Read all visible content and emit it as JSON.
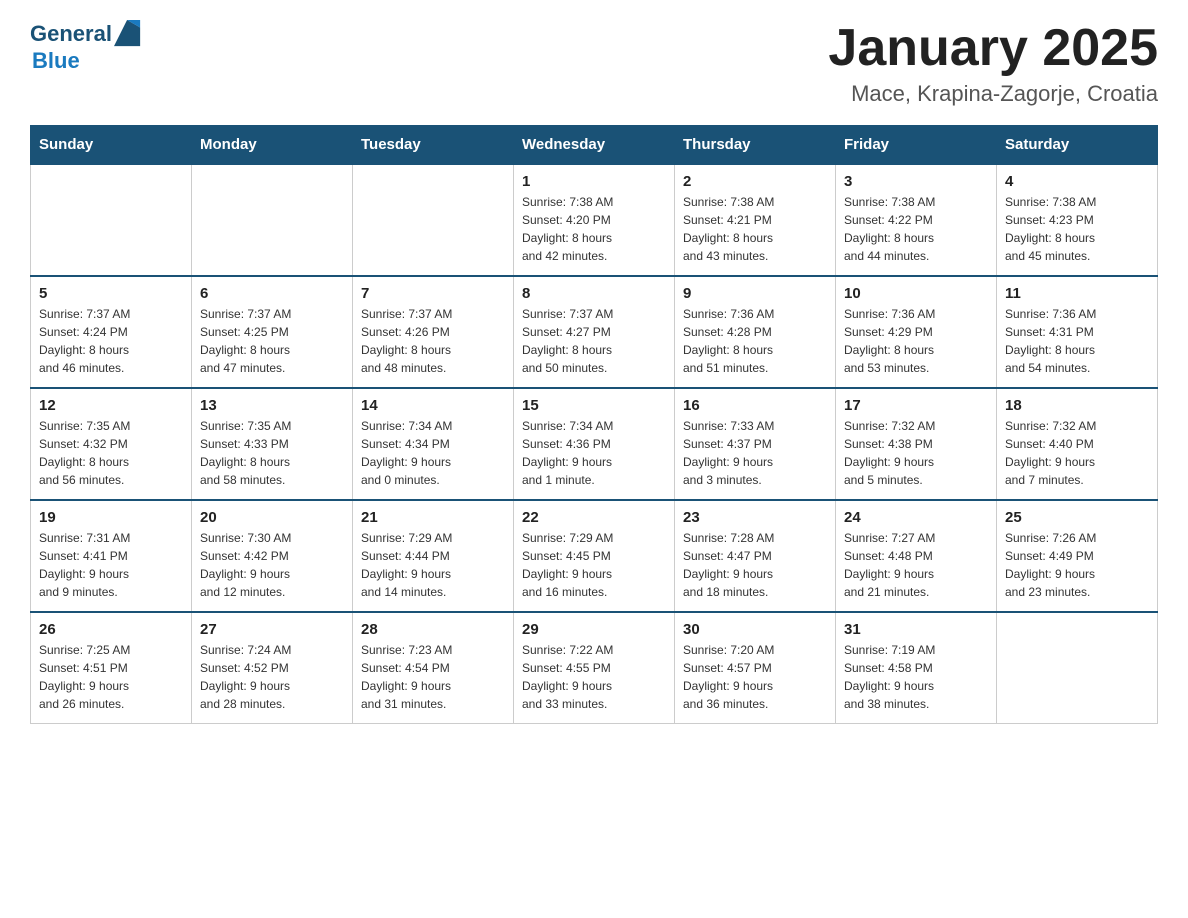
{
  "header": {
    "title": "January 2025",
    "subtitle": "Mace, Krapina-Zagorje, Croatia",
    "logo_general": "General",
    "logo_blue": "Blue"
  },
  "days_of_week": [
    "Sunday",
    "Monday",
    "Tuesday",
    "Wednesday",
    "Thursday",
    "Friday",
    "Saturday"
  ],
  "weeks": [
    [
      {
        "day": "",
        "info": ""
      },
      {
        "day": "",
        "info": ""
      },
      {
        "day": "",
        "info": ""
      },
      {
        "day": "1",
        "info": "Sunrise: 7:38 AM\nSunset: 4:20 PM\nDaylight: 8 hours\nand 42 minutes."
      },
      {
        "day": "2",
        "info": "Sunrise: 7:38 AM\nSunset: 4:21 PM\nDaylight: 8 hours\nand 43 minutes."
      },
      {
        "day": "3",
        "info": "Sunrise: 7:38 AM\nSunset: 4:22 PM\nDaylight: 8 hours\nand 44 minutes."
      },
      {
        "day": "4",
        "info": "Sunrise: 7:38 AM\nSunset: 4:23 PM\nDaylight: 8 hours\nand 45 minutes."
      }
    ],
    [
      {
        "day": "5",
        "info": "Sunrise: 7:37 AM\nSunset: 4:24 PM\nDaylight: 8 hours\nand 46 minutes."
      },
      {
        "day": "6",
        "info": "Sunrise: 7:37 AM\nSunset: 4:25 PM\nDaylight: 8 hours\nand 47 minutes."
      },
      {
        "day": "7",
        "info": "Sunrise: 7:37 AM\nSunset: 4:26 PM\nDaylight: 8 hours\nand 48 minutes."
      },
      {
        "day": "8",
        "info": "Sunrise: 7:37 AM\nSunset: 4:27 PM\nDaylight: 8 hours\nand 50 minutes."
      },
      {
        "day": "9",
        "info": "Sunrise: 7:36 AM\nSunset: 4:28 PM\nDaylight: 8 hours\nand 51 minutes."
      },
      {
        "day": "10",
        "info": "Sunrise: 7:36 AM\nSunset: 4:29 PM\nDaylight: 8 hours\nand 53 minutes."
      },
      {
        "day": "11",
        "info": "Sunrise: 7:36 AM\nSunset: 4:31 PM\nDaylight: 8 hours\nand 54 minutes."
      }
    ],
    [
      {
        "day": "12",
        "info": "Sunrise: 7:35 AM\nSunset: 4:32 PM\nDaylight: 8 hours\nand 56 minutes."
      },
      {
        "day": "13",
        "info": "Sunrise: 7:35 AM\nSunset: 4:33 PM\nDaylight: 8 hours\nand 58 minutes."
      },
      {
        "day": "14",
        "info": "Sunrise: 7:34 AM\nSunset: 4:34 PM\nDaylight: 9 hours\nand 0 minutes."
      },
      {
        "day": "15",
        "info": "Sunrise: 7:34 AM\nSunset: 4:36 PM\nDaylight: 9 hours\nand 1 minute."
      },
      {
        "day": "16",
        "info": "Sunrise: 7:33 AM\nSunset: 4:37 PM\nDaylight: 9 hours\nand 3 minutes."
      },
      {
        "day": "17",
        "info": "Sunrise: 7:32 AM\nSunset: 4:38 PM\nDaylight: 9 hours\nand 5 minutes."
      },
      {
        "day": "18",
        "info": "Sunrise: 7:32 AM\nSunset: 4:40 PM\nDaylight: 9 hours\nand 7 minutes."
      }
    ],
    [
      {
        "day": "19",
        "info": "Sunrise: 7:31 AM\nSunset: 4:41 PM\nDaylight: 9 hours\nand 9 minutes."
      },
      {
        "day": "20",
        "info": "Sunrise: 7:30 AM\nSunset: 4:42 PM\nDaylight: 9 hours\nand 12 minutes."
      },
      {
        "day": "21",
        "info": "Sunrise: 7:29 AM\nSunset: 4:44 PM\nDaylight: 9 hours\nand 14 minutes."
      },
      {
        "day": "22",
        "info": "Sunrise: 7:29 AM\nSunset: 4:45 PM\nDaylight: 9 hours\nand 16 minutes."
      },
      {
        "day": "23",
        "info": "Sunrise: 7:28 AM\nSunset: 4:47 PM\nDaylight: 9 hours\nand 18 minutes."
      },
      {
        "day": "24",
        "info": "Sunrise: 7:27 AM\nSunset: 4:48 PM\nDaylight: 9 hours\nand 21 minutes."
      },
      {
        "day": "25",
        "info": "Sunrise: 7:26 AM\nSunset: 4:49 PM\nDaylight: 9 hours\nand 23 minutes."
      }
    ],
    [
      {
        "day": "26",
        "info": "Sunrise: 7:25 AM\nSunset: 4:51 PM\nDaylight: 9 hours\nand 26 minutes."
      },
      {
        "day": "27",
        "info": "Sunrise: 7:24 AM\nSunset: 4:52 PM\nDaylight: 9 hours\nand 28 minutes."
      },
      {
        "day": "28",
        "info": "Sunrise: 7:23 AM\nSunset: 4:54 PM\nDaylight: 9 hours\nand 31 minutes."
      },
      {
        "day": "29",
        "info": "Sunrise: 7:22 AM\nSunset: 4:55 PM\nDaylight: 9 hours\nand 33 minutes."
      },
      {
        "day": "30",
        "info": "Sunrise: 7:20 AM\nSunset: 4:57 PM\nDaylight: 9 hours\nand 36 minutes."
      },
      {
        "day": "31",
        "info": "Sunrise: 7:19 AM\nSunset: 4:58 PM\nDaylight: 9 hours\nand 38 minutes."
      },
      {
        "day": "",
        "info": ""
      }
    ]
  ]
}
